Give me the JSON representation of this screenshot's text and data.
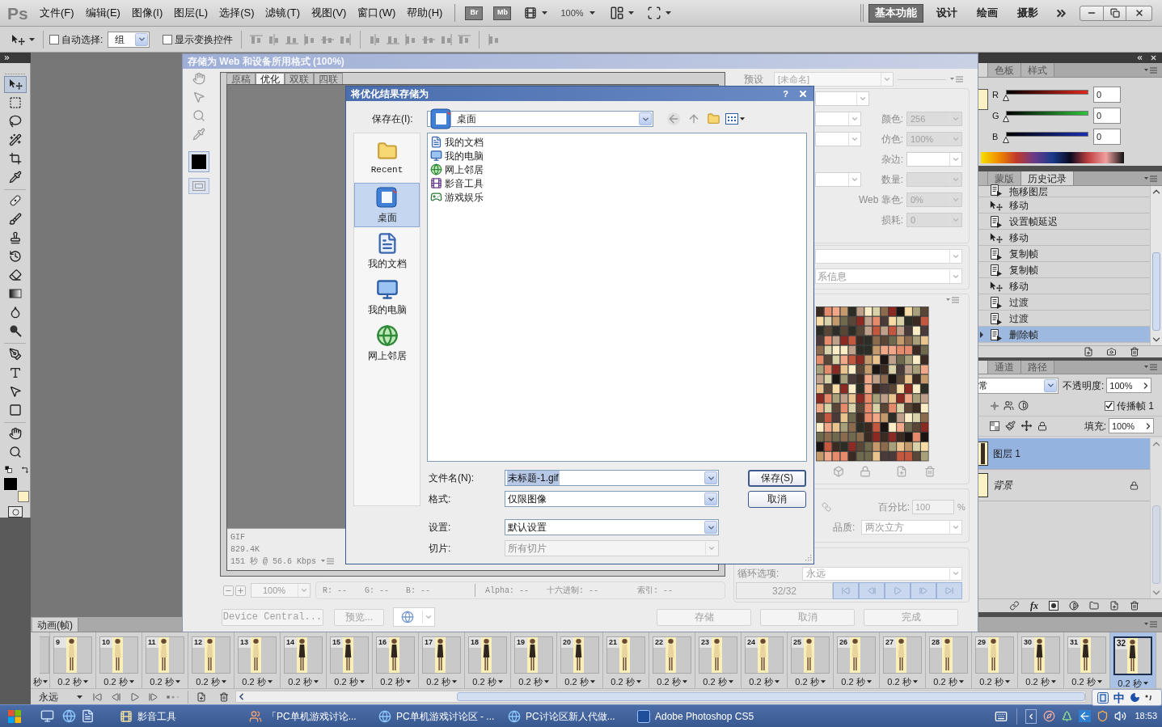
{
  "menubar": {
    "logo": "Ps",
    "menus": [
      "文件(F)",
      "编辑(E)",
      "图像(I)",
      "图层(L)",
      "选择(S)",
      "滤镜(T)",
      "视图(V)",
      "窗口(W)",
      "帮助(H)"
    ],
    "bridge": "Br",
    "mini_bridge": "Mb",
    "zoom": "100%",
    "workspaces": [
      {
        "label": "基本功能",
        "selected": true
      },
      {
        "label": "设计",
        "selected": false
      },
      {
        "label": "绘画",
        "selected": false
      },
      {
        "label": "摄影",
        "selected": false
      }
    ]
  },
  "options_bar": {
    "auto_select": {
      "label": "自动选择:",
      "checked": false
    },
    "auto_select_target": "组",
    "show_transform": {
      "label": "显示变换控件",
      "checked": false
    }
  },
  "tools": [
    {
      "kind": "move",
      "selected": true
    },
    {
      "kind": "marquee",
      "selected": false
    },
    {
      "kind": "lasso",
      "selected": false
    },
    {
      "kind": "quick_select",
      "selected": false
    },
    {
      "kind": "crop",
      "selected": false
    },
    {
      "kind": "eyedropper",
      "selected": false
    },
    {
      "kind": "healing",
      "selected": false
    },
    {
      "kind": "brush",
      "selected": false
    },
    {
      "kind": "stamp",
      "selected": false
    },
    {
      "kind": "history_brush",
      "selected": false
    },
    {
      "kind": "eraser",
      "selected": false
    },
    {
      "kind": "gradient",
      "selected": false
    },
    {
      "kind": "blur",
      "selected": false
    },
    {
      "kind": "dodge",
      "selected": false
    },
    {
      "kind": "pen",
      "selected": false
    },
    {
      "kind": "type",
      "selected": false
    },
    {
      "kind": "path_select",
      "selected": false
    },
    {
      "kind": "shape",
      "selected": false
    },
    {
      "kind": "hand",
      "selected": false
    },
    {
      "kind": "zoom",
      "selected": false
    }
  ],
  "save_for_web": {
    "title": "存储为 Web 和设备所用格式 (100%)",
    "tabs": [
      {
        "label": "原稿",
        "selected": false
      },
      {
        "label": "优化",
        "selected": true
      },
      {
        "label": "双联",
        "selected": false
      },
      {
        "label": "四联",
        "selected": false
      }
    ],
    "info": [
      "GIF",
      "829.4K",
      "151 秒 @ 56.6 Kbps"
    ],
    "zoom": "100%",
    "readouts": [
      "R: --",
      "G: --",
      "B: --",
      "Alpha: --",
      "十六进制: --",
      "索引: --"
    ],
    "left_buttons": [
      "Device Central...",
      "预览..."
    ],
    "right_buttons": [
      "存储",
      "取消",
      "完成"
    ],
    "preset_label": "预设",
    "preset": "[未命名]",
    "settings": [
      {
        "kind": "field",
        "disabled": false
      },
      {
        "kind": "split",
        "label": "颜色:",
        "value": "256",
        "disabled": true
      },
      {
        "kind": "split",
        "label": "仿色:",
        "value": "100%",
        "disabled": true
      },
      {
        "kind": "labeled",
        "label": "杂边:",
        "disabled": false
      },
      {
        "kind": "split",
        "label": "数量:",
        "disabled": true
      },
      {
        "kind": "labeled",
        "label": "Web 靠色:",
        "value": "0%",
        "disabled": true
      },
      {
        "kind": "labeled",
        "label": "损耗:",
        "value": "0",
        "disabled": true
      }
    ],
    "metadata": "系信息",
    "image_size": {
      "percent_label": "百分比:",
      "percent": "100",
      "unit": "%",
      "quality_label": "品质:",
      "quality": "两次立方"
    },
    "loop": {
      "label": "循环选项:",
      "value": "永远"
    },
    "frame_counter": "32/32"
  },
  "save_dialog": {
    "title": "将优化结果存储为",
    "help": "?",
    "location_label": "保存在(I):",
    "location": "桌面",
    "places": [
      {
        "label": "Recent",
        "kind": "recent",
        "selected": false
      },
      {
        "label": "桌面",
        "kind": "desktop",
        "selected": true
      },
      {
        "label": "我的文档",
        "kind": "documents",
        "selected": false
      },
      {
        "label": "我的电脑",
        "kind": "computer",
        "selected": false
      },
      {
        "label": "网上邻居",
        "kind": "network",
        "selected": false
      }
    ],
    "files": [
      {
        "name": "我的文档",
        "kind": "documents"
      },
      {
        "name": "我的电脑",
        "kind": "computer"
      },
      {
        "name": "网上邻居",
        "kind": "network"
      },
      {
        "name": "影音工具",
        "kind": "media"
      },
      {
        "name": "游戏娱乐",
        "kind": "games"
      }
    ],
    "fields": [
      {
        "label": "文件名(N):",
        "value": "未标题-1.gif",
        "text_selected": true,
        "disabled": false
      },
      {
        "label": "格式:",
        "value": "仅限图像",
        "text_selected": false,
        "disabled": false
      },
      {
        "label": "设置:",
        "value": "默认设置",
        "text_selected": false,
        "disabled": false
      },
      {
        "label": "切片:",
        "value": "所有切片",
        "text_selected": false,
        "disabled": true
      }
    ],
    "buttons": [
      "保存(S)",
      "取消"
    ]
  },
  "color_panel": {
    "tabs": [
      {
        "selected": true
      },
      {
        "label": "色板",
        "selected": false
      },
      {
        "label": "样式",
        "selected": false
      }
    ],
    "channels": [
      {
        "name": "R",
        "value": "0",
        "level": 0
      },
      {
        "name": "G",
        "value": "0",
        "level": 0
      },
      {
        "name": "B",
        "value": "0",
        "level": 0
      }
    ]
  },
  "history_panel": {
    "tabs": [
      {
        "selected": false
      },
      {
        "label": "蒙版",
        "selected": false
      },
      {
        "label": "历史记录",
        "selected": true
      }
    ],
    "items": [
      {
        "label": "拖移图层",
        "kind": "step",
        "selected": false
      },
      {
        "label": "移动",
        "kind": "move",
        "selected": false
      },
      {
        "label": "设置帧延迟",
        "kind": "step",
        "selected": false
      },
      {
        "label": "移动",
        "kind": "move",
        "selected": false
      },
      {
        "label": "复制帧",
        "kind": "step",
        "selected": false
      },
      {
        "label": "复制帧",
        "kind": "step",
        "selected": false
      },
      {
        "label": "移动",
        "kind": "move",
        "selected": false
      },
      {
        "label": "过渡",
        "kind": "step",
        "selected": false
      },
      {
        "label": "过渡",
        "kind": "step",
        "selected": false
      },
      {
        "label": "删除帧",
        "kind": "step",
        "selected": true
      }
    ]
  },
  "layers_panel": {
    "tabs": [
      {
        "selected": true
      },
      {
        "label": "通道",
        "selected": false
      },
      {
        "label": "路径",
        "selected": false
      }
    ],
    "blend_mode": "常",
    "opacity_label": "不透明度:",
    "opacity": "100%",
    "propagate": {
      "label": "传播帧 1",
      "checked": true
    },
    "fill_label": "填充:",
    "fill": "100%",
    "layers": [
      {
        "name": "图层 1",
        "kind": "layer",
        "selected": true,
        "locked": false
      },
      {
        "name": "背景",
        "kind": "background",
        "selected": false,
        "locked": true
      }
    ],
    "effects_button": "fx"
  },
  "animation_panel": {
    "title": "动画(帧)",
    "partial_frame_delay": "秒",
    "frames": [
      {
        "number": "9",
        "delay": "0.2 秒",
        "selected": false
      },
      {
        "number": "10",
        "delay": "0.2 秒",
        "selected": false
      },
      {
        "number": "11",
        "delay": "0.2 秒",
        "selected": false
      },
      {
        "number": "12",
        "delay": "0.2 秒",
        "selected": false
      },
      {
        "number": "13",
        "delay": "0.2 秒",
        "selected": false
      },
      {
        "number": "14",
        "delay": "0.2 秒",
        "selected": false
      },
      {
        "number": "15",
        "delay": "0.2 秒",
        "selected": false
      },
      {
        "number": "16",
        "delay": "0.2 秒",
        "selected": false
      },
      {
        "number": "17",
        "delay": "0.2 秒",
        "selected": false
      },
      {
        "number": "18",
        "delay": "0.2 秒",
        "selected": false
      },
      {
        "number": "19",
        "delay": "0.2 秒",
        "selected": false
      },
      {
        "number": "20",
        "delay": "0.2 秒",
        "selected": false
      },
      {
        "number": "21",
        "delay": "0.2 秒",
        "selected": false
      },
      {
        "number": "22",
        "delay": "0.2 秒",
        "selected": false
      },
      {
        "number": "23",
        "delay": "0.2 秒",
        "selected": false
      },
      {
        "number": "24",
        "delay": "0.2 秒",
        "selected": false
      },
      {
        "number": "25",
        "delay": "0.2 秒",
        "selected": false
      },
      {
        "number": "26",
        "delay": "0.2 秒",
        "selected": false
      },
      {
        "number": "27",
        "delay": "0.2 秒",
        "selected": false
      },
      {
        "number": "28",
        "delay": "0.2 秒",
        "selected": false
      },
      {
        "number": "29",
        "delay": "0.2 秒",
        "selected": false
      },
      {
        "number": "30",
        "delay": "0.2 秒",
        "selected": false
      },
      {
        "number": "31",
        "delay": "0.2 秒",
        "selected": false
      },
      {
        "number": "32",
        "delay": "0.2 秒",
        "selected": true
      }
    ],
    "loop": "永远"
  },
  "ime_bar": {
    "mode": "中"
  },
  "taskbar": {
    "tasks": [
      {
        "label": "影音工具",
        "kind": "media"
      },
      {
        "label": "「PC单机游戏讨论...",
        "kind": "chat"
      },
      {
        "label": "PC单机游戏讨论区 - ...",
        "kind": "browser"
      },
      {
        "label": "PC讨论区新人代做...",
        "kind": "browser"
      },
      {
        "label": "Adobe Photoshop CS5",
        "kind": "photoshop"
      }
    ],
    "clock": "18:53"
  }
}
